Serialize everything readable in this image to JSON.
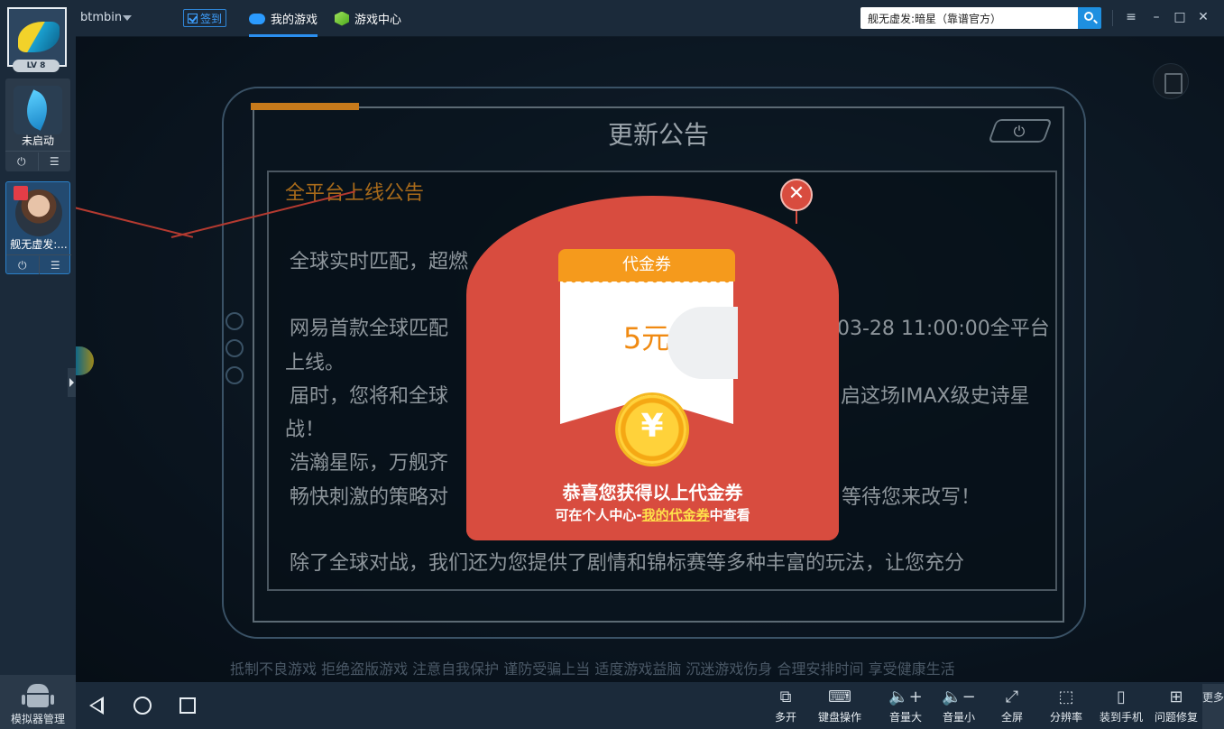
{
  "topbar": {
    "username": "btmbin",
    "signin_label": "签到",
    "tabs": [
      {
        "label": "我的游戏"
      },
      {
        "label": "游戏中心"
      }
    ],
    "search_value": "舰无虚发:暗星（靠谱官方）"
  },
  "sidebar": {
    "level": "LV 8",
    "apps": [
      {
        "label": "未启动"
      },
      {
        "label": "舰无虚发:..."
      }
    ],
    "manager_label": "模拟器管理"
  },
  "notice": {
    "title": "更新公告",
    "heading": "全平台上线公告",
    "lines": [
      "全球实时匹配，超燃",
      "网易首款全球匹配",
      "03-28 11:00:00全平台",
      "上线。",
      "届时，您将和全球",
      "启这场IMAX级史诗星",
      "战！",
      "浩瀚星际，万舰齐",
      "畅快刺激的策略对",
      "等待您来改写！",
      "除了全球对战，我们还为您提供了剧情和锦标赛等多种丰富的玩法，让您充分"
    ],
    "marquee": "抵制不良游戏  拒绝盗版游戏  注意自我保护  谨防受骗上当  适度游戏益脑  沉迷游戏伤身  合理安排时间  享受健康生活"
  },
  "popup": {
    "voucher_title": "代金券",
    "voucher_amount": "5元",
    "coin_symbol": "¥",
    "congrats": "恭喜您获得以上代金券",
    "view_prefix": "可在个人中心-",
    "view_link": "我的代金券",
    "view_suffix": "中查看",
    "close_symbol": "✕"
  },
  "bottombar": {
    "tools": [
      {
        "label": "多开",
        "icon": "multi-window-icon"
      },
      {
        "label": "键盘操作",
        "icon": "keyboard-icon"
      },
      {
        "label": "音量大",
        "icon": "volume-up-icon"
      },
      {
        "label": "音量小",
        "icon": "volume-down-icon"
      },
      {
        "label": "全屏",
        "icon": "fullscreen-icon"
      },
      {
        "label": "分辨率",
        "icon": "resolution-icon"
      },
      {
        "label": "装到手机",
        "icon": "phone-icon"
      },
      {
        "label": "问题修复",
        "icon": "repair-icon"
      }
    ],
    "more_label": "更多"
  },
  "colors": {
    "envelope_red": "#d84c3f",
    "voucher_orange": "#f59a1c",
    "accent_blue": "#2b8ff0",
    "link_yellow": "#ffe14a"
  }
}
